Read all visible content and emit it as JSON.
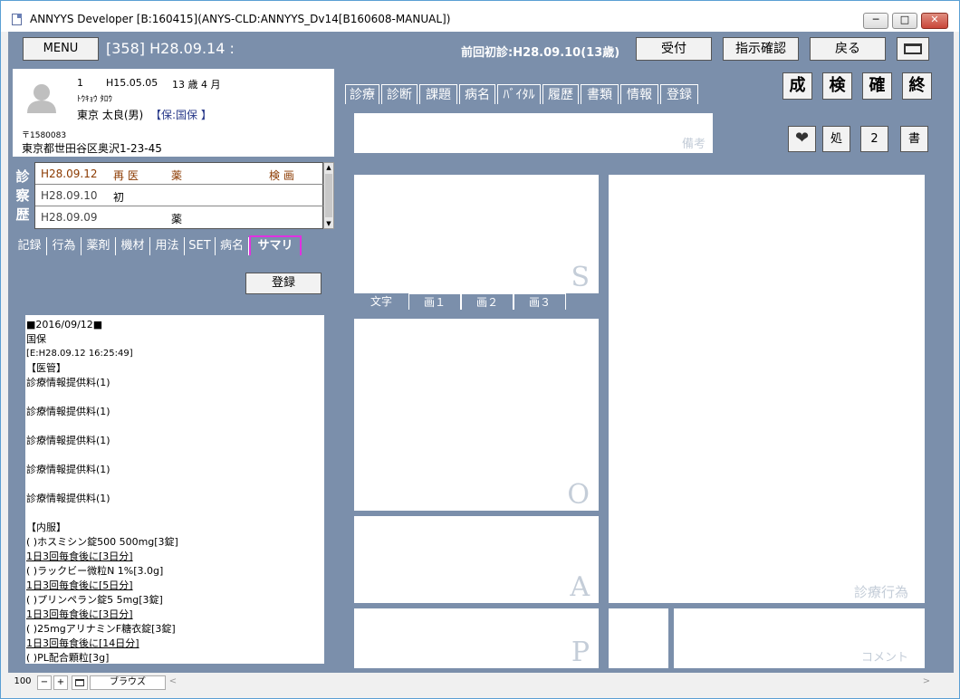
{
  "window": {
    "title": "ANNYYS Developer [B:160415](ANYS-CLD:ANNYYS_Dv14[B160608-MANUAL])",
    "minimize": "─",
    "maximize": "□",
    "close": "✕"
  },
  "header": {
    "menu_label": "MENU",
    "visit_info": "[358] H28.09.14 :",
    "prev_visit": "前回初診:H28.09.10(13歳)",
    "reception_label": "受付",
    "instruction_label": "指示確認",
    "back_label": "戻る"
  },
  "patient": {
    "number": "1",
    "birth_date": "H15.05.05",
    "age": "13 歳 4 月",
    "kana": "ﾄｳｷｮｳ ﾀﾛｳ",
    "name": "東京 太良(男)",
    "insurance": "【保:国保 】",
    "postal": "〒1580083",
    "address": "東京都世田谷区奥沢1-23-45"
  },
  "history": {
    "label": [
      "診",
      "察",
      "歴"
    ],
    "rows": [
      {
        "date": "H28.09.12",
        "kind": "再 医",
        "med": "薬",
        "extra": "検 画"
      },
      {
        "date": "H28.09.10",
        "kind": "初",
        "med": "",
        "extra": ""
      },
      {
        "date": "H28.09.09",
        "kind": "",
        "med": "薬",
        "extra": ""
      }
    ]
  },
  "left_tabs": [
    "記録",
    "行為",
    "薬剤",
    "機材",
    "用法",
    "SET",
    "病名",
    "サマリ"
  ],
  "summary": {
    "register_label": "登録",
    "lines": [
      "■2016/09/12■",
      "国保",
      "[E:H28.09.12  16:25:49]",
      "【医管】",
      "診療情報提供料(1)",
      "",
      "診療情報提供料(1)",
      "",
      "診療情報提供料(1)",
      "",
      "診療情報提供料(1)",
      "",
      "診療情報提供料(1)",
      "",
      "【内服】",
      "(  )ホスミシン錠500  500mg[3錠]",
      "1日3回毎食後に[3日分]",
      "(  )ラックビー微粒N  1%[3.0g]",
      "1日3回毎食後に[5日分]",
      "(  )プリンペラン錠5  5mg[3錠]",
      "1日3回毎食後に[3日分]",
      "(  )25mgアリナミンF糖衣錠[3錠]",
      "1日3回毎食後に[14日分]",
      "(  )PL配合顆粒[3g]"
    ]
  },
  "right_tabs": [
    "診療",
    "診断",
    "課題",
    "病名",
    "ﾊﾞｲﾀﾙ",
    "履歴",
    "書類",
    "情報",
    "登録"
  ],
  "side_buttons": [
    "成",
    "検",
    "確",
    "終"
  ],
  "notes_placeholder": "備考",
  "icon_buttons": [
    "処",
    "2",
    "書"
  ],
  "soap": {
    "s": "S",
    "o": "O",
    "a": "A",
    "p": "P"
  },
  "o_tabs": [
    "文字",
    "画１",
    "画２",
    "画３"
  ],
  "acts_label": "診療行為",
  "comment_label": "コメント",
  "statusbar": {
    "zoom": "100",
    "minus": "−",
    "plus": "+",
    "view": "ブラウズ",
    "arrow_left": "<",
    "arrow_right": ">"
  }
}
